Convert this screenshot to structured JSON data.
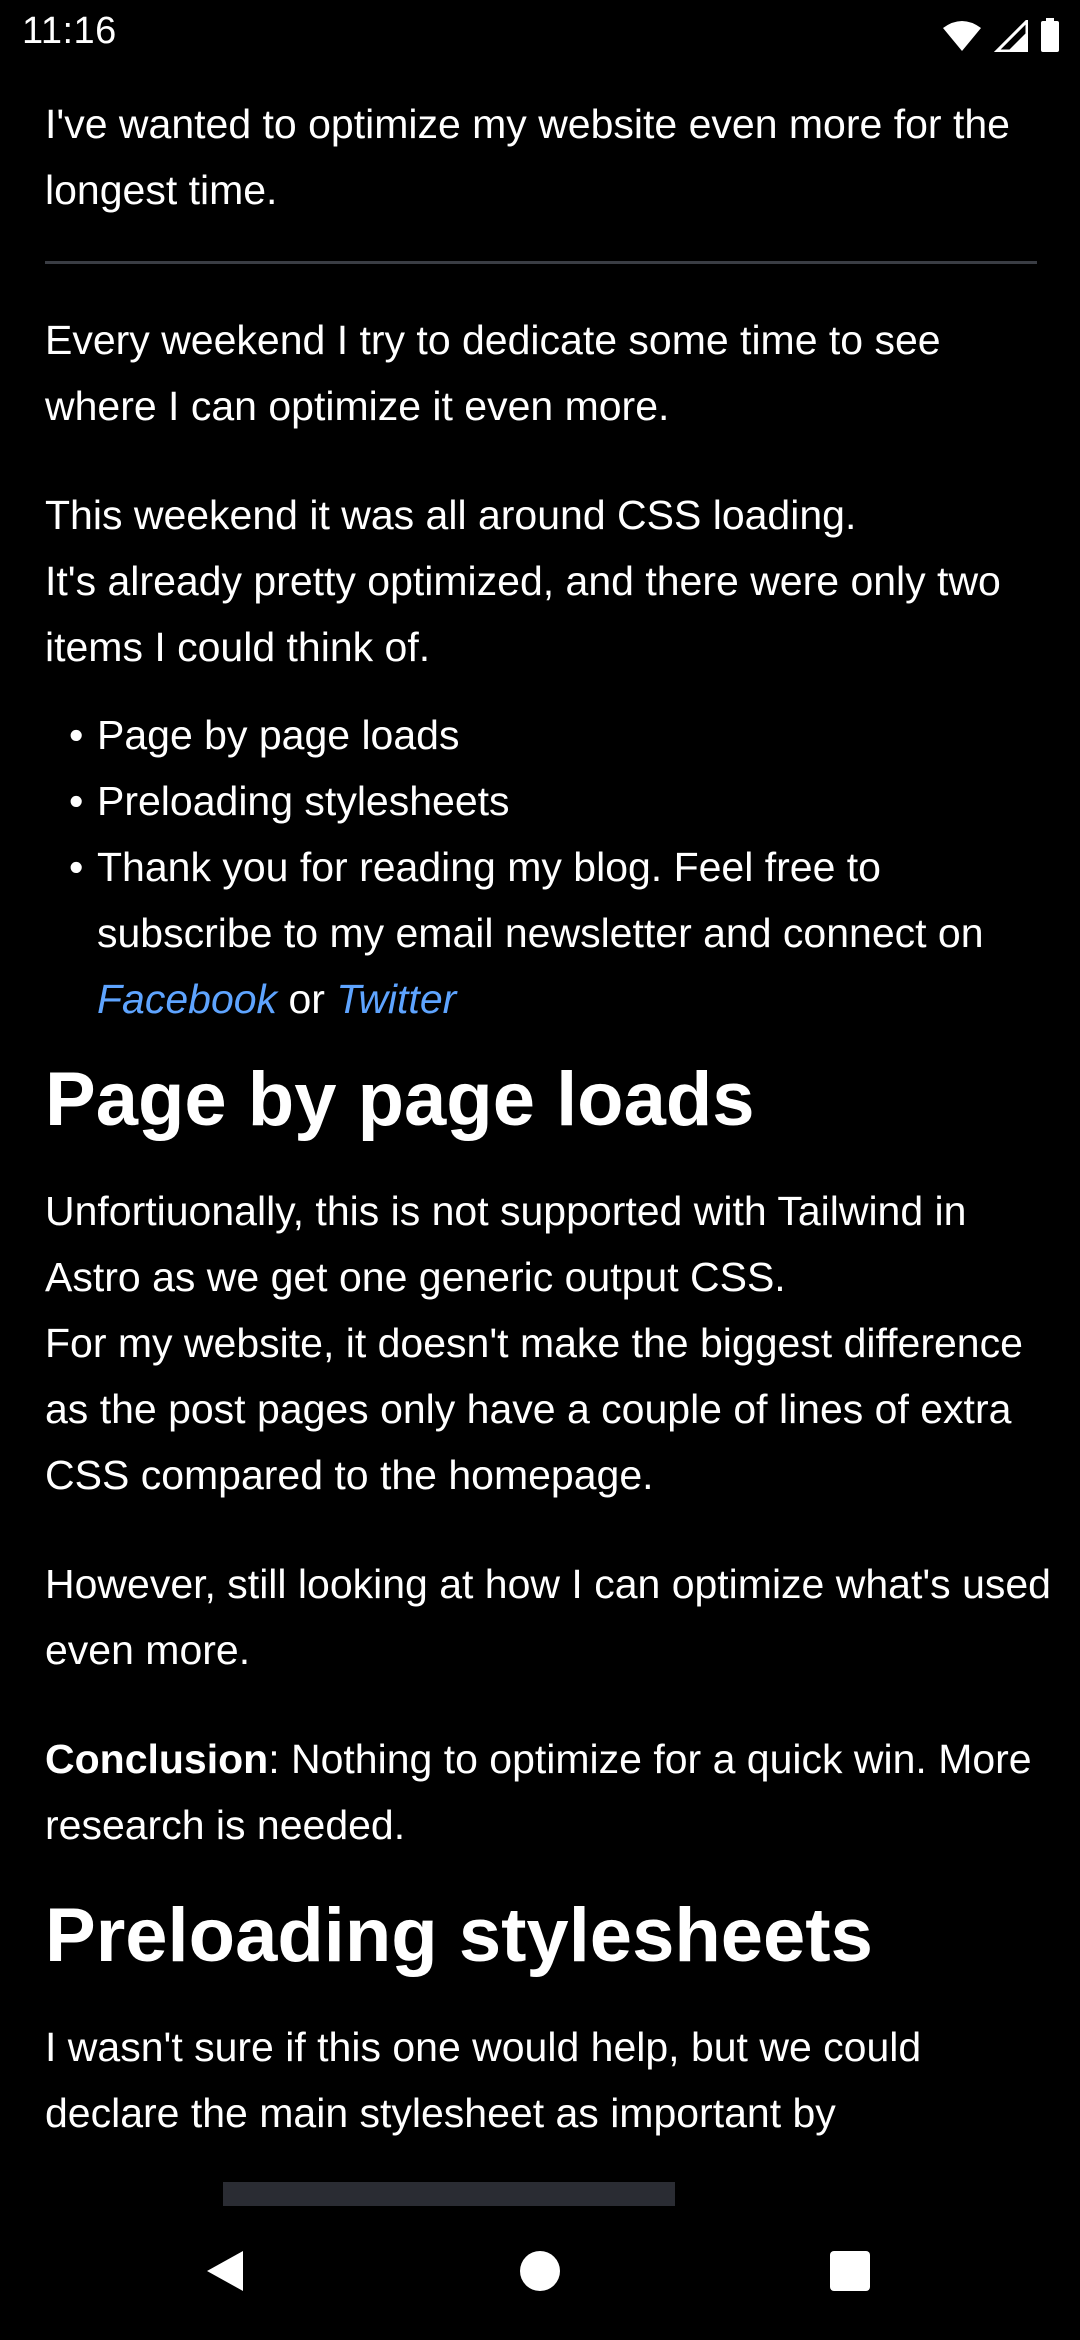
{
  "status_bar": {
    "time": "11:16",
    "icons": [
      "wifi-icon",
      "cell-signal-icon",
      "battery-icon"
    ]
  },
  "article": {
    "intro": "I've wanted to optimize my website even more for the longest time.",
    "para_weekend": "Every weekend I try to dedicate some time to see where I can optimize it even more.",
    "para_css_1": "This weekend it was all around CSS loading.",
    "para_css_2": "It's already pretty optimized, and there were only two items I could think of.",
    "list": {
      "item_1": "Page by page loads",
      "item_2": "Preloading stylesheets",
      "item_3_prefix": "Thank you for reading my blog. Feel free to subscribe to my email newsletter and connect on ",
      "facebook_link": "Facebook",
      "or_text": " or ",
      "twitter_link": "Twitter"
    },
    "heading_1": "Page by page loads",
    "para_tailwind_1": "Unfortiuonally, this is not supported with Tailwind in Astro as we get one generic output CSS.",
    "para_tailwind_2": "For my website, it doesn't make the biggest difference as the post pages only have a couple of lines of extra CSS compared to the homepage.",
    "para_however": "However, still looking at how I can optimize what's used even more.",
    "conclusion_label": "Conclusion",
    "conclusion_text": ": Nothing to optimize for a quick win. More research is needed.",
    "heading_2": "Preloading stylesheets",
    "para_preload_1": "I wasn't sure if this one would help, but we could",
    "para_preload_2": "declare the main stylesheet as important by"
  },
  "colors": {
    "background": "#000000",
    "text": "#ffffff",
    "link": "#5ea4ff",
    "divider": "#3a3d44"
  },
  "nav_bar": {
    "icons": [
      "back-icon",
      "home-icon",
      "recents-icon"
    ]
  }
}
